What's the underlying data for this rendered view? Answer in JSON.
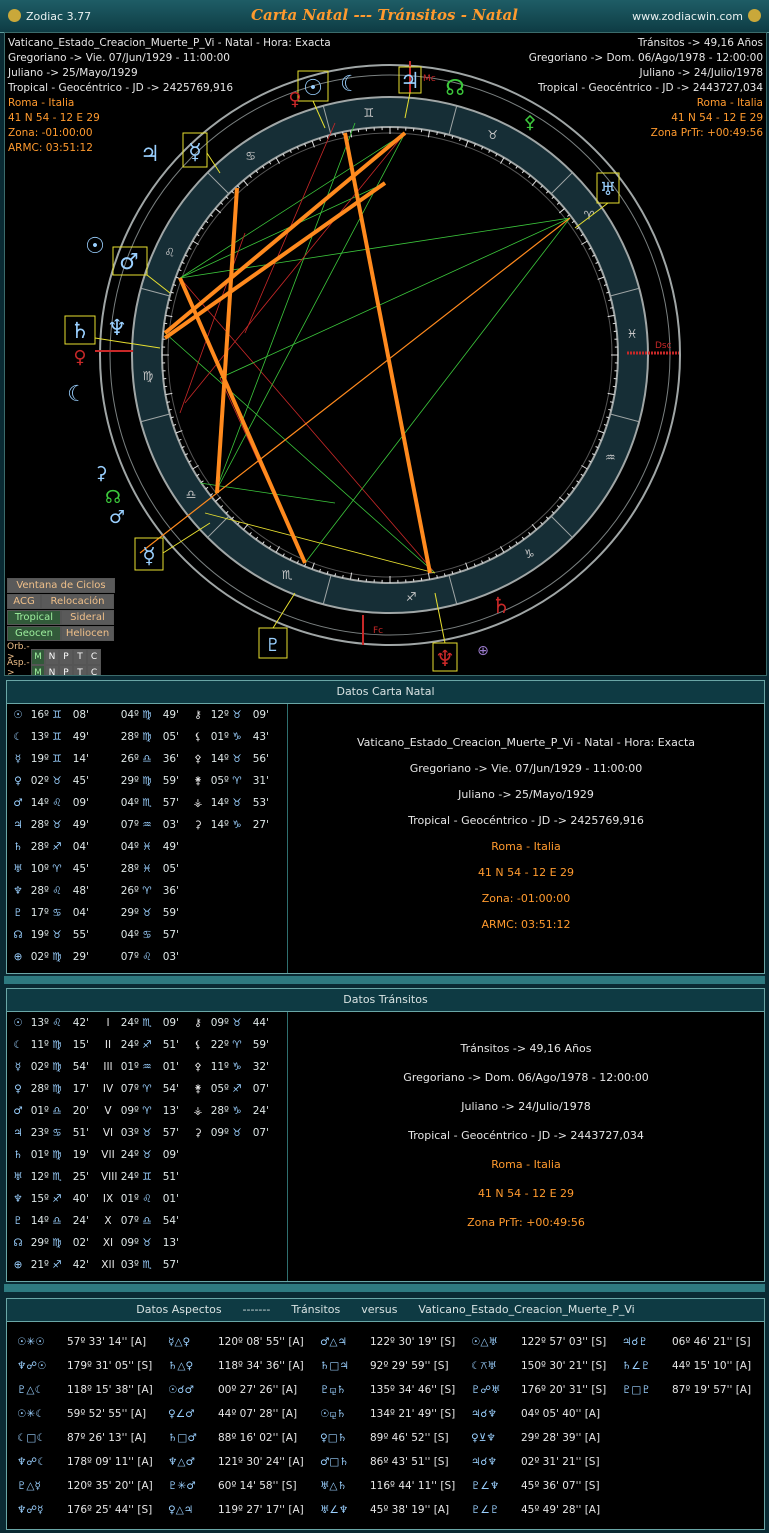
{
  "titlebar": {
    "app": "Zodiac 3.77",
    "title": "Carta Natal --- Tránsitos - Natal",
    "site": "www.zodiacwin.com"
  },
  "chart": {
    "left_info": [
      "Vaticano_Estado_Creacion_Muerte_P_Vi - Natal - Hora: Exacta",
      "Gregoriano -> Vie. 07/Jun/1929 - 11:00:00",
      "Juliano -> 25/Mayo/1929",
      "Tropical - Geocéntrico - JD -> 2425769,916",
      "Roma - Italia",
      "41 N 54 - 12 E 29",
      "Zona: -01:00:00",
      "ARMC: 03:51:12"
    ],
    "right_info": [
      "Tránsitos -> 49,16 Años",
      "Gregoriano -> Dom. 06/Ago/1978 - 12:00:00",
      "Juliano -> 24/Julio/1978",
      "Tropical - Geocéntrico - JD -> 2443727,034",
      "Roma - Italia",
      "41 N 54 - 12 E 29",
      "Zona PrTr: +00:49:56"
    ],
    "labels": {
      "mc": "Mc",
      "asc": "Asc",
      "dsc": "Dsc",
      "fc": "Fc"
    },
    "colors": {
      "aspect_orange": "#ff8a1e",
      "aspect_green": "#3cc83c",
      "aspect_red": "#c82828",
      "aspect_yellow": "#e8e030",
      "ring": "#9aa0a0"
    }
  },
  "buttons": {
    "ciclos": "Ventana de Ciclos",
    "acg": "ACG",
    "relocacion": "Relocación",
    "tropical": "Tropical",
    "sideral": "Sideral",
    "geocen": "Geocen",
    "heliocen": "Heliocen",
    "orb_label": "Orb.->",
    "asp_label": "Asp.->",
    "orb_opts": [
      "M",
      "N",
      "P",
      "T",
      "C"
    ],
    "asp_opts": [
      "M",
      "N",
      "P",
      "T",
      "C"
    ]
  },
  "natal": {
    "header": "Datos Carta Natal",
    "rows": [
      [
        [
          "☉",
          "16º",
          "♊",
          "08'"
        ],
        [
          "",
          "04º",
          "♍",
          "49'"
        ],
        [
          "⚷",
          "12º",
          "♉",
          "09'"
        ]
      ],
      [
        [
          "☾",
          "13º",
          "♊",
          "49'"
        ],
        [
          "",
          "28º",
          "♍",
          "05'"
        ],
        [
          "⚸",
          "01º",
          "♑",
          "43'"
        ]
      ],
      [
        [
          "☿",
          "19º",
          "♊",
          "14'"
        ],
        [
          "",
          "26º",
          "♎",
          "36'"
        ],
        [
          "⚴",
          "14º",
          "♉",
          "56'"
        ]
      ],
      [
        [
          "♀",
          "02º",
          "♉",
          "45'"
        ],
        [
          "",
          "29º",
          "♍",
          "59'"
        ],
        [
          "⚵",
          "05º",
          "♈",
          "31'"
        ]
      ],
      [
        [
          "♂",
          "14º",
          "♌",
          "09'"
        ],
        [
          "",
          "04º",
          "♏",
          "57'"
        ],
        [
          "⚶",
          "14º",
          "♉",
          "53'"
        ]
      ],
      [
        [
          "♃",
          "28º",
          "♉",
          "49'"
        ],
        [
          "",
          "07º",
          "♒",
          "03'"
        ],
        [
          "⚳",
          "14º",
          "♑",
          "27'"
        ]
      ],
      [
        [
          "♄",
          "28º",
          "♐",
          "04'"
        ],
        [
          "",
          "04º",
          "♓",
          "49'"
        ],
        [
          "",
          "",
          "",
          ""
        ]
      ],
      [
        [
          "♅",
          "10º",
          "♈",
          "45'"
        ],
        [
          "",
          "28º",
          "♓",
          "05'"
        ],
        [
          "",
          "",
          "",
          ""
        ]
      ],
      [
        [
          "♆",
          "28º",
          "♌",
          "48'"
        ],
        [
          "",
          "26º",
          "♈",
          "36'"
        ],
        [
          "",
          "",
          "",
          ""
        ]
      ],
      [
        [
          "♇",
          "17º",
          "♋",
          "04'"
        ],
        [
          "",
          "29º",
          "♉",
          "59'"
        ],
        [
          "",
          "",
          "",
          ""
        ]
      ],
      [
        [
          "☊",
          "19º",
          "♉",
          "55'"
        ],
        [
          "",
          "04º",
          "♋",
          "57'"
        ],
        [
          "",
          "",
          "",
          ""
        ]
      ],
      [
        [
          "⊕",
          "02º",
          "♍",
          "29'"
        ],
        [
          "",
          "07º",
          "♌",
          "03'"
        ],
        [
          "",
          "",
          "",
          ""
        ]
      ]
    ],
    "details": [
      "Vaticano_Estado_Creacion_Muerte_P_Vi - Natal - Hora: Exacta",
      "Gregoriano -> Vie. 07/Jun/1929 - 11:00:00",
      "Juliano -> 25/Mayo/1929",
      "Tropical - Geocéntrico - JD -> 2425769,916",
      "Roma - Italia",
      "41 N 54 - 12 E 29",
      "Zona: -01:00:00",
      "ARMC: 03:51:12"
    ]
  },
  "transits": {
    "header": "Datos Tránsitos",
    "rows": [
      [
        [
          "☉",
          "13º",
          "♌",
          "42'"
        ],
        [
          "I",
          "24º",
          "♏",
          "09'"
        ],
        [
          "⚷",
          "09º",
          "♉",
          "44'"
        ]
      ],
      [
        [
          "☾",
          "11º",
          "♍",
          "15'"
        ],
        [
          "II",
          "24º",
          "♐",
          "51'"
        ],
        [
          "⚸",
          "22º",
          "♈",
          "59'"
        ]
      ],
      [
        [
          "☿",
          "02º",
          "♍",
          "54'"
        ],
        [
          "III",
          "01º",
          "♒",
          "01'"
        ],
        [
          "⚴",
          "11º",
          "♑",
          "32'"
        ]
      ],
      [
        [
          "♀",
          "28º",
          "♍",
          "17'"
        ],
        [
          "IV",
          "07º",
          "♈",
          "54'"
        ],
        [
          "⚵",
          "05º",
          "♐",
          "07'"
        ]
      ],
      [
        [
          "♂",
          "01º",
          "♎",
          "20'"
        ],
        [
          "V",
          "09º",
          "♈",
          "13'"
        ],
        [
          "⚶",
          "28º",
          "♑",
          "24'"
        ]
      ],
      [
        [
          "♃",
          "23º",
          "♋",
          "51'"
        ],
        [
          "VI",
          "03º",
          "♉",
          "57'"
        ],
        [
          "⚳",
          "09º",
          "♉",
          "07'"
        ]
      ],
      [
        [
          "♄",
          "01º",
          "♍",
          "19'"
        ],
        [
          "VII",
          "24º",
          "♉",
          "09'"
        ],
        [
          "",
          "",
          "",
          ""
        ]
      ],
      [
        [
          "♅",
          "12º",
          "♏",
          "25'"
        ],
        [
          "VIII",
          "24º",
          "♊",
          "51'"
        ],
        [
          "",
          "",
          "",
          ""
        ]
      ],
      [
        [
          "♆",
          "15º",
          "♐",
          "40'"
        ],
        [
          "IX",
          "01º",
          "♌",
          "01'"
        ],
        [
          "",
          "",
          "",
          ""
        ]
      ],
      [
        [
          "♇",
          "14º",
          "♎",
          "24'"
        ],
        [
          "X",
          "07º",
          "♎",
          "54'"
        ],
        [
          "",
          "",
          "",
          ""
        ]
      ],
      [
        [
          "☊",
          "29º",
          "♍",
          "02'"
        ],
        [
          "XI",
          "09º",
          "♉",
          "13'"
        ],
        [
          "",
          "",
          "",
          ""
        ]
      ],
      [
        [
          "⊕",
          "21º",
          "♐",
          "42'"
        ],
        [
          "XII",
          "03º",
          "♏",
          "57'"
        ],
        [
          "",
          "",
          "",
          ""
        ]
      ]
    ],
    "details": [
      "Tránsitos -> 49,16 Años",
      "Gregoriano -> Dom. 06/Ago/1978 - 12:00:00",
      "Juliano -> 24/Julio/1978",
      "Tropical - Geocéntrico - JD -> 2443727,034",
      "Roma - Italia",
      "41 N 54 - 12 E 29",
      "Zona PrTr: +00:49:56"
    ]
  },
  "aspects": {
    "header": "Datos Aspectos      -------      Tránsitos      versus      Vaticano_Estado_Creacion_Muerte_P_Vi",
    "columns": [
      [
        [
          "☉✳☉",
          "57º 33' 14'' [A]"
        ],
        [
          "♆☍☉",
          "179º 31' 05'' [S]"
        ],
        [
          "♇△☾",
          "118º 15' 38'' [A]"
        ],
        [
          "☉✳☾",
          "59º 52' 55'' [A]"
        ],
        [
          "☾□☾",
          "87º 26' 13'' [A]"
        ],
        [
          "♆☍☾",
          "178º 09' 11'' [A]"
        ],
        [
          "♇△☿",
          "120º 35' 20'' [A]"
        ],
        [
          "♆☍☿",
          "176º 25' 44'' [S]"
        ]
      ],
      [
        [
          "☿△♀",
          "120º 08' 55'' [A]"
        ],
        [
          "♄△♀",
          "118º 34' 36'' [A]"
        ],
        [
          "☉☌♂",
          "00º 27' 26'' [A]"
        ],
        [
          "♀∠♂",
          "44º 07' 28'' [A]"
        ],
        [
          "♄□♂",
          "88º 16' 02'' [A]"
        ],
        [
          "♆△♂",
          "121º 30' 24'' [A]"
        ],
        [
          "♇✳♂",
          "60º 14' 58'' [S]"
        ],
        [
          "♀△♃",
          "119º 27' 17'' [A]"
        ]
      ],
      [
        [
          "♂△♃",
          "122º 30' 19'' [S]"
        ],
        [
          "♄□♃",
          "92º 29' 59'' [S]"
        ],
        [
          "♇⚼♄",
          "135º 34' 46'' [S]"
        ],
        [
          "☉⚼♄",
          "134º 21' 49'' [S]"
        ],
        [
          "♀□♄",
          "89º 46' 52'' [S]"
        ],
        [
          "♂□♄",
          "86º 43' 51'' [S]"
        ],
        [
          "♅△♄",
          "116º 44' 11'' [S]"
        ],
        [
          "♅∠♆",
          "45º 38' 19'' [A]"
        ]
      ],
      [
        [
          "☉△♅",
          "122º 57' 03'' [S]"
        ],
        [
          "☾⚻♅",
          "150º 30' 21'' [S]"
        ],
        [
          "♇☍♅",
          "176º 20' 31'' [S]"
        ],
        [
          "♃☌♆",
          "04º 05' 40'' [A]"
        ],
        [
          "♀⊻♆",
          "29º 28' 39'' [A]"
        ],
        [
          "♃☌♆",
          "02º 31' 21'' [S]"
        ],
        [
          "♇∠♆",
          "45º 36' 07'' [S]"
        ],
        [
          "♇∠♇",
          "45º 49' 28'' [A]"
        ]
      ],
      [
        [
          "♃☌♇",
          "06º 46' 21'' [S]"
        ],
        [
          "♄∠♇",
          "44º 15' 10'' [A]"
        ],
        [
          "♇□♇",
          "87º 19' 57'' [A]"
        ]
      ]
    ]
  }
}
